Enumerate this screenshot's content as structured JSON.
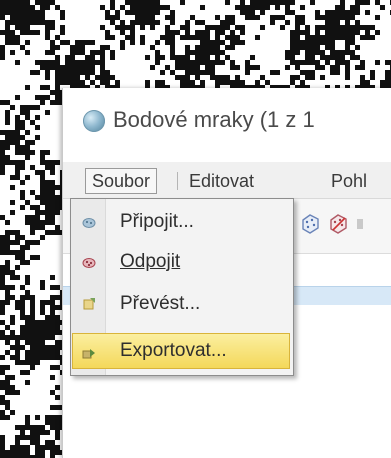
{
  "window": {
    "title": "Bodové mraky (1 z 1"
  },
  "menubar": {
    "items": [
      {
        "label": "Soubor",
        "active": true
      },
      {
        "label": "Editovat",
        "active": false
      },
      {
        "label": "Pohl",
        "active": false
      }
    ]
  },
  "dropdown": {
    "items": [
      {
        "label": "Připojit...",
        "icon": "connect-icon",
        "highlighted": false
      },
      {
        "label": "Odpojit",
        "icon": "disconnect-icon",
        "highlighted": false
      },
      {
        "label": "Převést...",
        "icon": "convert-icon",
        "highlighted": false
      },
      {
        "label": "Exportovat...",
        "icon": "export-icon",
        "highlighted": true
      }
    ]
  },
  "toolbar": {
    "icons": [
      "point-cloud-icon",
      "point-cloud-remove-icon"
    ]
  },
  "colors": {
    "highlight": "#f4d85a",
    "header_blue": "#d7e8f7",
    "menu_bg": "#f3f3f3"
  }
}
